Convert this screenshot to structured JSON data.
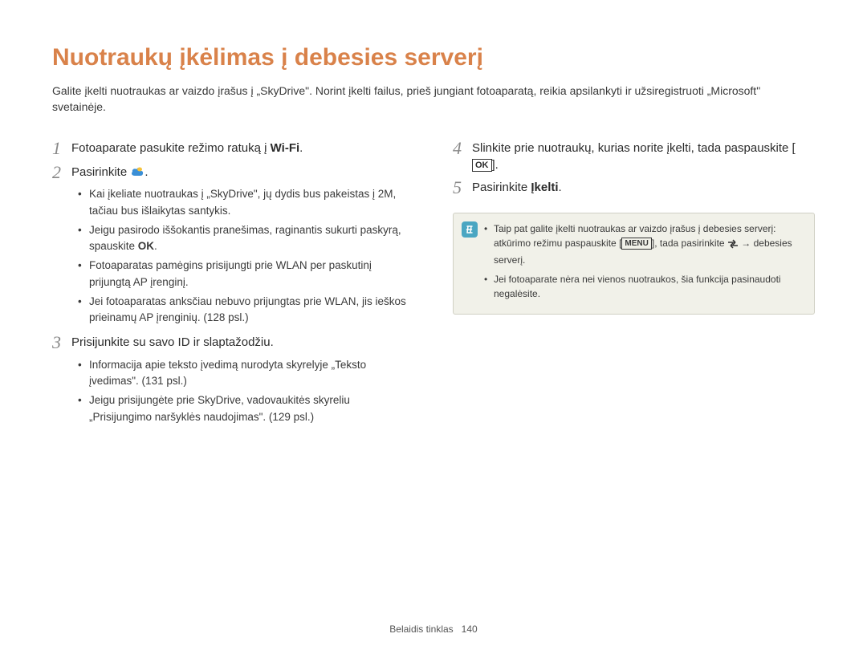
{
  "title": "Nuotraukų įkėlimas į debesies serverį",
  "intro": "Galite įkelti nuotraukas ar vaizdo įrašus į „SkyDrive\". Norint įkelti failus, prieš jungiant fotoaparatą, reikia apsilankyti ir užsiregistruoti „Microsoft\" svetainėje.",
  "left": {
    "step1_pre": "Fotoaparate pasukite režimo ratuką į ",
    "step1_wifi": "Wi-Fi",
    "step1_post": ".",
    "step2_pre": "Pasirinkite ",
    "step2_post": ".",
    "step2_sub": [
      "Kai įkeliate nuotraukas į „SkyDrive\", jų dydis bus pakeistas į 2M, tačiau bus išlaikytas santykis.",
      [
        "Jeigu pasirodo iššokantis pranešimas, raginantis sukurti paskyrą, spauskite ",
        "OK",
        "."
      ],
      "Fotoaparatas pamėgins prisijungti prie WLAN per paskutinį prijungtą AP įrenginį.",
      "Jei fotoaparatas anksčiau nebuvo prijungtas prie WLAN, jis ieškos prieinamų AP įrenginių. (128 psl.)"
    ],
    "step3": "Prisijunkite su savo ID ir slaptažodžiu.",
    "step3_sub": [
      "Informacija apie teksto įvedimą nurodyta skyrelyje „Teksto įvedimas\". (131 psl.)",
      "Jeigu prisijungėte prie SkyDrive, vadovaukitės skyreliu „Prisijungimo naršyklės naudojimas\". (129 psl.)"
    ]
  },
  "right": {
    "step4_pre": "Slinkite prie nuotraukų, kurias norite įkelti, tada paspauskite [",
    "step4_ok": "OK",
    "step4_post": "].",
    "step5_pre": "Pasirinkite ",
    "step5_bold": "Įkelti",
    "step5_post": ".",
    "note": {
      "n1_a": "Taip pat galite įkelti nuotraukas ar vaizdo įrašus į debesies serverį: atkūrimo režimu paspauskite [",
      "n1_menu": "MENU",
      "n1_b": "], tada pasirinkite ",
      "n1_c": " → debesies serverį.",
      "n2": "Jei fotoaparate nėra nei vienos nuotraukos, šia funkcija pasinaudoti negalėsite."
    }
  },
  "footer": {
    "section": "Belaidis tinklas",
    "page": "140"
  }
}
